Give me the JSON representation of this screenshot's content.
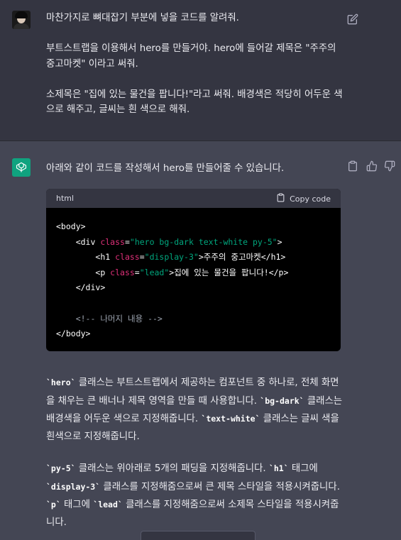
{
  "user_message": {
    "line1": "마찬가지로 뼈대잡기 부분에 넣을 코드를 알려줘.",
    "line2": "부트스트랩을 이용해서 hero를 만들거야. hero에 들어갈 제목은 \"주주의 중고마켓\" 이라고 써줘.",
    "line3": "소제목은 \"집에 있는 물건을 팝니다!\"라고 써줘. 배경색은 적당히 어두운 색으로 해주고, 글씨는 흰 색으로 해줘."
  },
  "assistant": {
    "intro": "아래와 같이 코드를 작성해서 hero를 만들어줄 수 있습니다.",
    "code": {
      "language": "html",
      "copy_label": "Copy code",
      "lines": {
        "l1": "<body>",
        "l2_open": "<div ",
        "l2_attr": "class",
        "l2_eq": "=",
        "l2_str": "\"hero bg-dark text-white py-5\"",
        "l2_close": ">",
        "l3_open": "<h1 ",
        "l3_attr": "class",
        "l3_eq": "=",
        "l3_str": "\"display-3\"",
        "l3_rest": ">주주의 중고마켓</h1>",
        "l4_open": "<p ",
        "l4_attr": "class",
        "l4_eq": "=",
        "l4_str": "\"lead\"",
        "l4_rest": ">집에 있는 물건을 팝니다!</p>",
        "l5": "</div>",
        "l7": "<!-- 나머지 내용 -->",
        "l8": "</body>"
      }
    },
    "para1": {
      "code_hero": "`hero`",
      "t1": " 클래스는 부트스트랩에서 제공하는 컴포넌트 중 하나로, 전체 화면을 채우는 큰 배너나 제목 영역을 만들 때 사용합니다. ",
      "code_bg": "`bg-dark`",
      "t2": " 클래스는 배경색을 어두운 색으로 지정해줍니다. ",
      "code_text": "`text-white`",
      "t3": " 클래스는 글씨 색을 흰색으로 지정해줍니다."
    },
    "para2": {
      "code_py": "`py-5`",
      "t1": " 클래스는 위아래로 5개의 패딩을 지정해줍니다. ",
      "code_h1": "`h1`",
      "t2": " 태그에 ",
      "code_display": "`display-3`",
      "t3": " 클래스를 지정해줌으로써 큰 제목 스타일을 적용시켜줍니다. ",
      "code_p": "`p`",
      "t4": " 태그에 ",
      "code_lead": "`lead`",
      "t5": " 클래스를 지정해줌으로써 소제목 스타일을 적용시켜줍니다."
    }
  },
  "icons": {
    "user_avatar": "user-avatar",
    "edit": "edit-icon",
    "assistant_avatar": "openai-logo-icon",
    "copy": "clipboard-icon",
    "thumbs_up": "thumbs-up-icon",
    "thumbs_down": "thumbs-down-icon"
  },
  "colors": {
    "user_bg": "#343541",
    "assistant_bg": "#444654",
    "gpt_green": "#10a37f",
    "code_attr": "#df3079",
    "code_string": "#00a67d"
  }
}
